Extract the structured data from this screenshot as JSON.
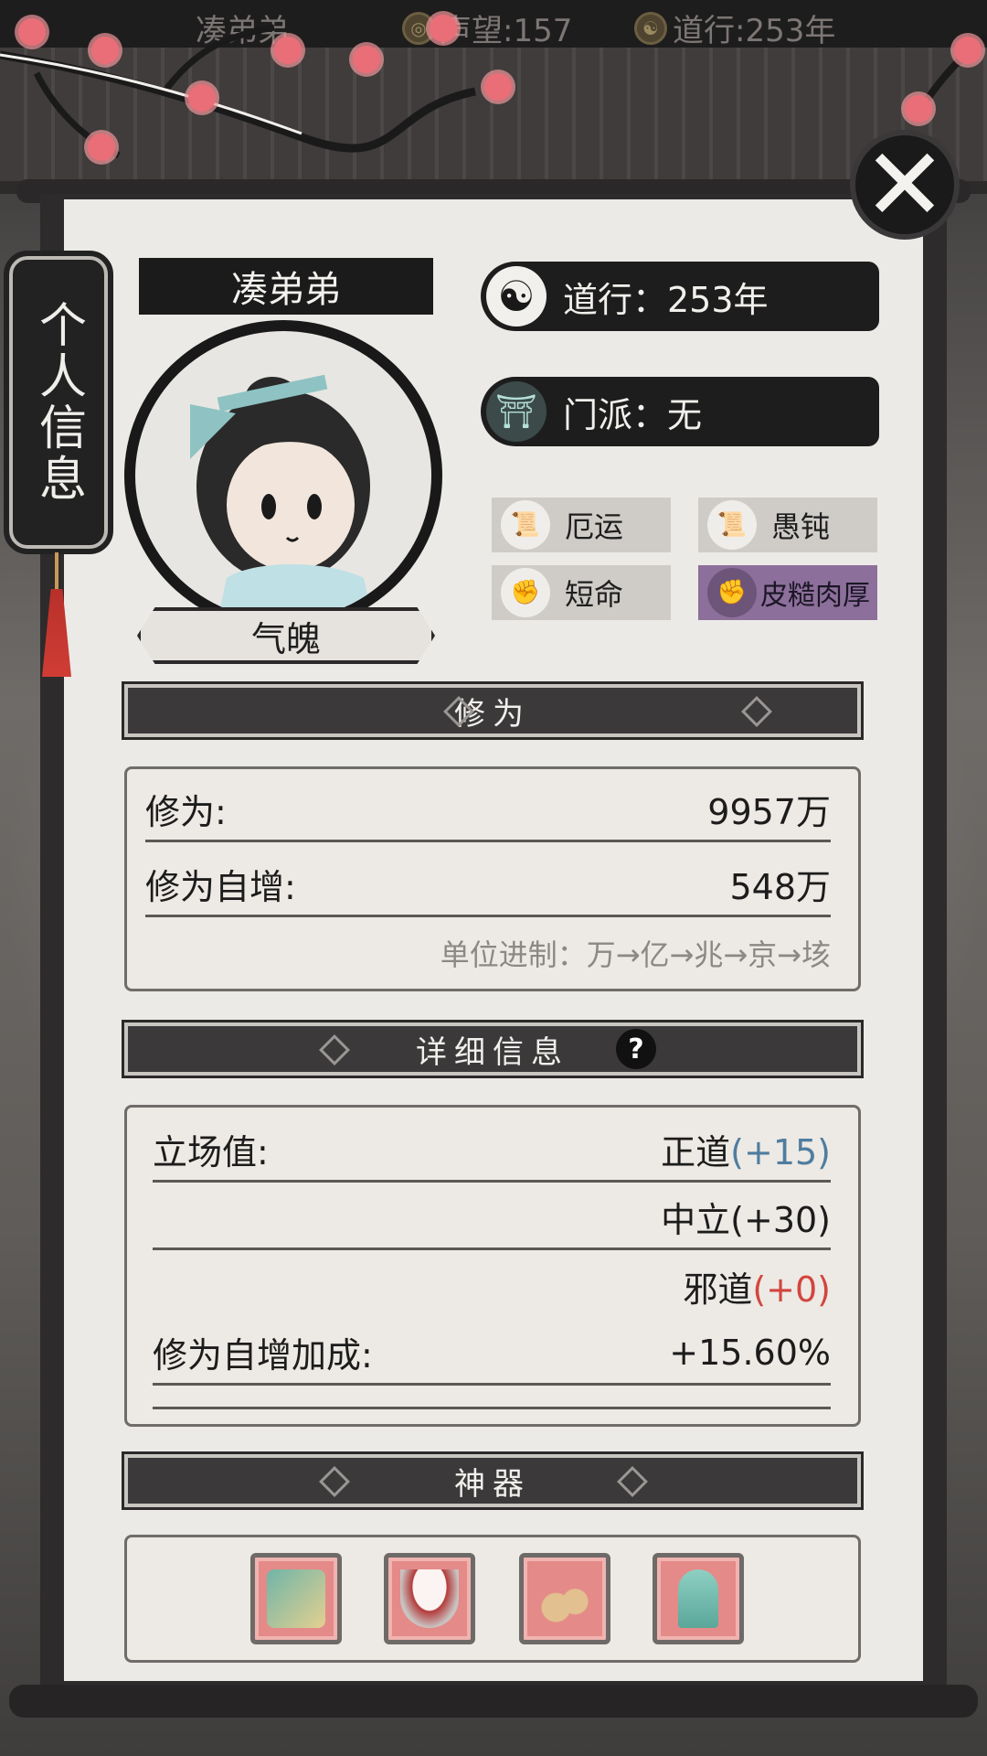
{
  "topbar": {
    "player_name": "凑弟弟",
    "reputation_label": "声望:157",
    "daoxing_label": "道行:253年"
  },
  "side_tab": {
    "label": "个人信息"
  },
  "profile": {
    "name": "凑弟弟",
    "qipo_label": "气魄",
    "daoxing": "道行：253年",
    "sect": "门派：无"
  },
  "traits": [
    {
      "label": "厄运",
      "icon": "scroll-icon"
    },
    {
      "label": "愚钝",
      "icon": "scroll-icon"
    },
    {
      "label": "短命",
      "icon": "fist-icon"
    },
    {
      "label": "皮糙肉厚",
      "icon": "fist-icon"
    }
  ],
  "cultivation": {
    "header": "修为",
    "rows": [
      {
        "label": "修为:",
        "value": "9957万"
      },
      {
        "label": "修为自增:",
        "value": "548万"
      }
    ],
    "unit_note": "单位进制：万→亿→兆→京→垓"
  },
  "details": {
    "header": "详细信息",
    "stance_label": "立场值:",
    "stances": [
      {
        "name": "正道",
        "bonus": "(+15)"
      },
      {
        "name": "中立",
        "bonus": "(+30)"
      },
      {
        "name": "邪道",
        "bonus": "(+0)"
      }
    ],
    "bonus_rows": [
      {
        "label": "修为自增加成:",
        "value": "+15.60%"
      }
    ]
  },
  "artifacts": {
    "header": "神器",
    "items": [
      "jade-comb-icon",
      "bowl-icon",
      "bell-icon",
      "jade-pendant-icon"
    ]
  },
  "colors": {
    "accent_blue": "#4e7da0",
    "accent_red": "#d2453f",
    "trait_highlight": "#8c6f9a"
  }
}
